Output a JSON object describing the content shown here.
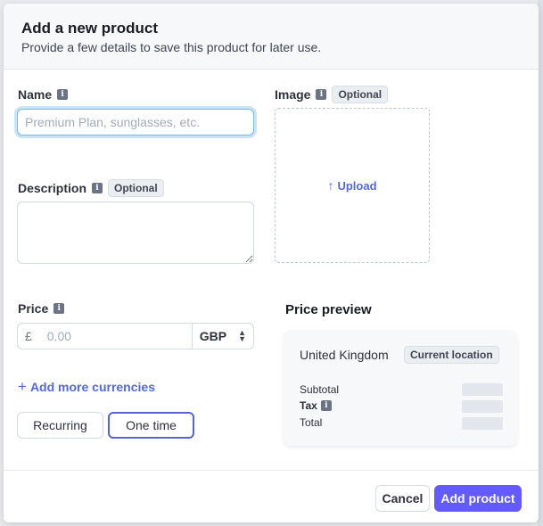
{
  "modal": {
    "title": "Add a new product",
    "subtitle": "Provide a few details to save this product for later use."
  },
  "name_field": {
    "label": "Name",
    "info_icon": "i",
    "placeholder": "Premium Plan, sunglasses, etc.",
    "value": ""
  },
  "image_field": {
    "label": "Image",
    "info_icon": "i",
    "badge": "Optional",
    "upload_icon": "↑",
    "upload_label": "Upload"
  },
  "description_field": {
    "label": "Description",
    "info_icon": "i",
    "badge": "Optional",
    "value": ""
  },
  "price_field": {
    "label": "Price",
    "info_icon": "i",
    "currency_symbol": "£",
    "placeholder": "0.00",
    "currency": "GBP",
    "sort_icon_up": "▲",
    "sort_icon_down": "▼"
  },
  "add_currencies": {
    "icon": "+",
    "label": "Add more currencies"
  },
  "billing_toggle": {
    "recurring": "Recurring",
    "one_time": "One time",
    "selected": "One time"
  },
  "price_preview": {
    "title": "Price preview",
    "country": "United Kingdom",
    "location_badge": "Current location",
    "subtotal_label": "Subtotal",
    "tax_label": "Tax",
    "tax_info_icon": "i",
    "total_label": "Total"
  },
  "footer": {
    "cancel": "Cancel",
    "add": "Add product"
  },
  "colors": {
    "accent": "#635bff",
    "link": "#5469d4",
    "focus_ring": "#7ab8e8"
  },
  "icons": {
    "info": "info-icon",
    "upload": "upload-arrow-icon",
    "plus": "plus-icon",
    "sort": "sort-icon"
  }
}
